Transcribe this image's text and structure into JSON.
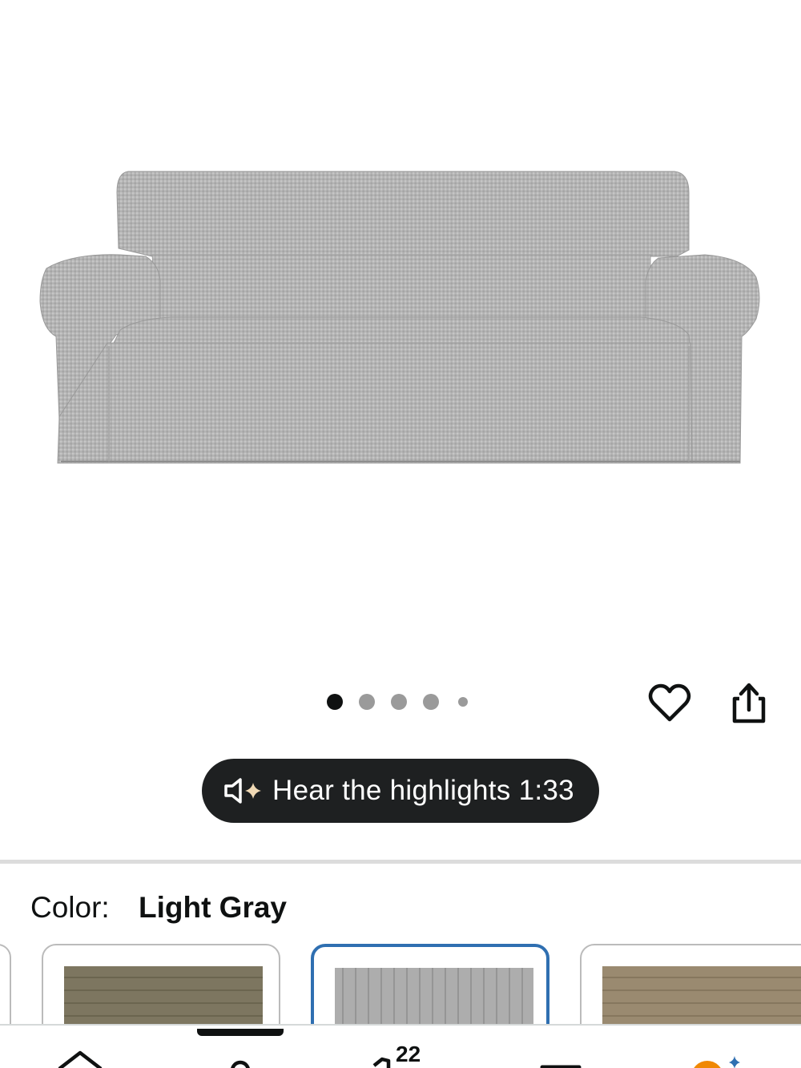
{
  "product": {
    "image_alt": "Light gray stretch sofa slipcover",
    "image_count": 5,
    "active_image": 1
  },
  "actions": {
    "wishlist_icon": "heart-icon",
    "share_icon": "share-icon"
  },
  "audio": {
    "label": "Hear the highlights 1:33",
    "icon": "speaker-sparkle-icon"
  },
  "color": {
    "label": "Color:",
    "value": "Light Gray"
  },
  "swatches": [
    {
      "name": "partial-left",
      "color": "#cfcfcf"
    },
    {
      "name": "olive",
      "color": "#7d7660"
    },
    {
      "name": "light-gray",
      "color": "#a9a9a9",
      "selected": true
    },
    {
      "name": "taupe",
      "color": "#9a8a70"
    }
  ],
  "nav": {
    "cart_count": "22",
    "items": [
      "home-icon",
      "profile-icon",
      "cart-icon",
      "menu-icon",
      "rufus-icon"
    ]
  },
  "colors": {
    "pill_bg": "#1e2021",
    "selected_border": "#2f6fb1",
    "dot_active": "#0f1111",
    "dot_inactive": "#9a9a9a",
    "rufus_orange": "#f08804",
    "rufus_blue": "#2f6fb1"
  }
}
